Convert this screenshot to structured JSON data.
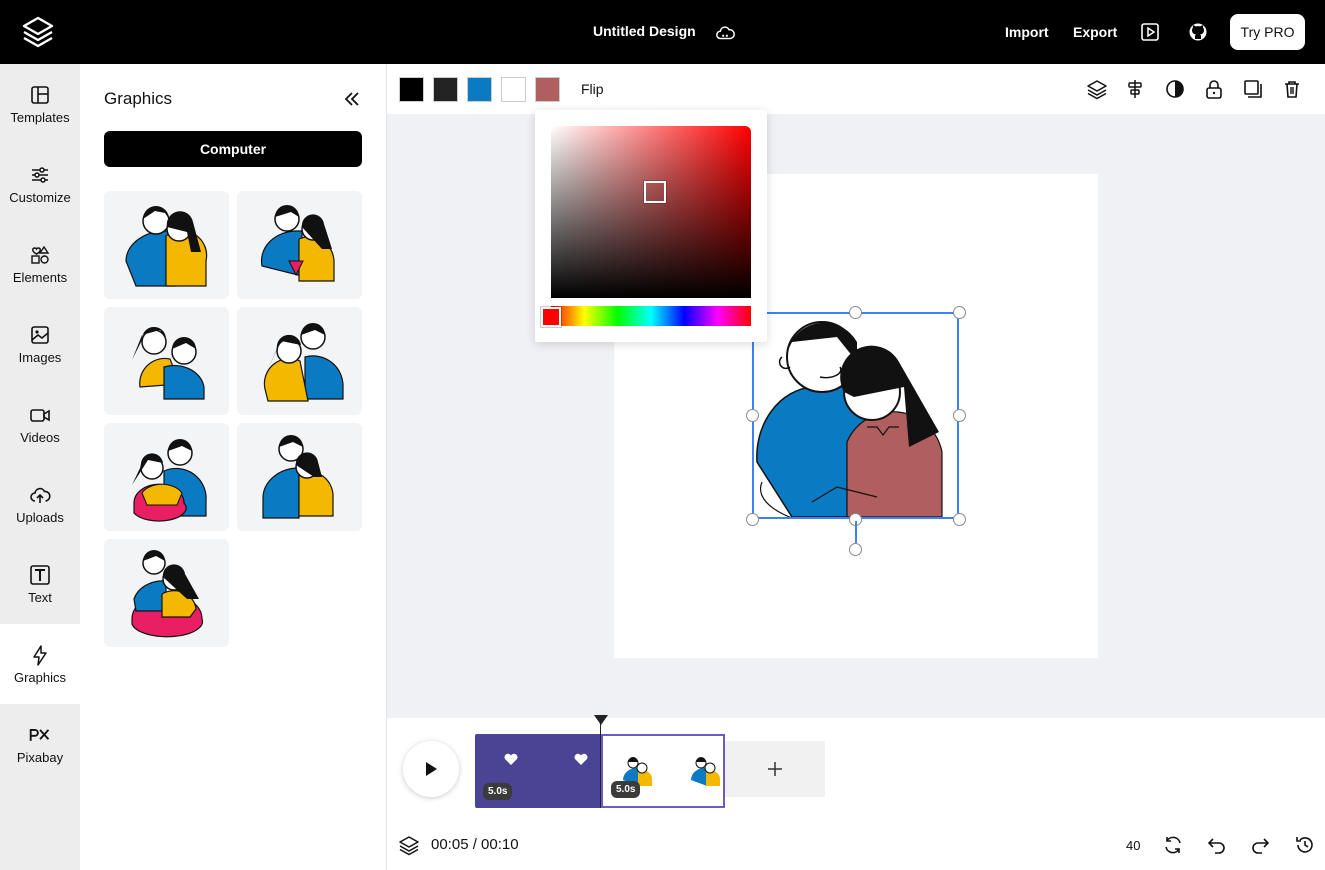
{
  "header": {
    "doc_title": "Untitled Design",
    "import_label": "Import",
    "export_label": "Export",
    "try_pro_label": "Try PRO"
  },
  "rail": {
    "items": [
      {
        "label": "Templates",
        "icon": "templates-icon"
      },
      {
        "label": "Customize",
        "icon": "sliders-icon"
      },
      {
        "label": "Elements",
        "icon": "shapes-icon"
      },
      {
        "label": "Images",
        "icon": "image-icon"
      },
      {
        "label": "Videos",
        "icon": "video-icon"
      },
      {
        "label": "Uploads",
        "icon": "cloud-upload-icon"
      },
      {
        "label": "Text",
        "icon": "text-icon"
      },
      {
        "label": "Graphics",
        "icon": "lightning-icon",
        "active": true
      },
      {
        "label": "Pixabay",
        "icon": "pixabay-icon"
      }
    ]
  },
  "panel": {
    "title": "Graphics",
    "computer_button": "Computer",
    "thumbnails": [
      "couple-illustration-1",
      "couple-illustration-2",
      "couple-illustration-3",
      "couple-illustration-4",
      "couple-illustration-5",
      "couple-illustration-6",
      "couple-illustration-7"
    ]
  },
  "toolbar": {
    "swatches": [
      "#000000",
      "#232323",
      "#0a7ac2",
      "#ffffff",
      "#b05f5e"
    ],
    "flip_label": "Flip"
  },
  "color_picker": {
    "hue_color": "#ff0000"
  },
  "timeline": {
    "current_time": "00:05",
    "total_time": "00:10",
    "time_display": "00:05 / 00:10",
    "clips": [
      {
        "duration": "5.0s"
      },
      {
        "duration": "5.0s"
      }
    ],
    "zoom": "40"
  },
  "colors": {
    "accent_selection": "#3b82f6",
    "clip_purple": "#4b4393",
    "blue_shirt": "#0a7ac2",
    "rose_shirt": "#b05f5e",
    "yellow": "#f5b800"
  }
}
